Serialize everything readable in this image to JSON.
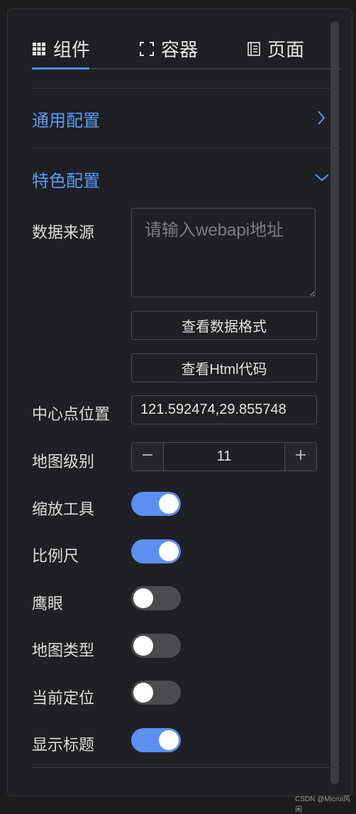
{
  "tabs": [
    {
      "label": "组件",
      "icon": "grid-icon",
      "active": true
    },
    {
      "label": "容器",
      "icon": "container-icon",
      "active": false
    },
    {
      "label": "页面",
      "icon": "page-icon",
      "active": false
    }
  ],
  "sections": {
    "general": {
      "title": "通用配置",
      "icon": "chevron-right-icon"
    },
    "special": {
      "title": "特色配置",
      "icon": "chevron-down-icon"
    }
  },
  "form": {
    "data_source": {
      "label": "数据来源",
      "placeholder": "请输入webapi地址",
      "value": ""
    },
    "view_format_button": "查看数据格式",
    "view_html_button": "查看Html代码",
    "center": {
      "label": "中心点位置",
      "value": "121.592474,29.855748"
    },
    "zoom": {
      "label": "地图级别",
      "value": "11",
      "minus": "−",
      "plus": "+"
    },
    "switches": [
      {
        "label": "缩放工具",
        "on": true
      },
      {
        "label": "比例尺",
        "on": true
      },
      {
        "label": "鹰眼",
        "on": false
      },
      {
        "label": "地图类型",
        "on": false
      },
      {
        "label": "当前定位",
        "on": false
      },
      {
        "label": "显示标题",
        "on": true
      }
    ]
  },
  "colors": {
    "accent": "#5b8ff2",
    "section_title": "#5b9af5",
    "background": "#1f2023"
  },
  "watermark": "CSDN @Microi风闲"
}
